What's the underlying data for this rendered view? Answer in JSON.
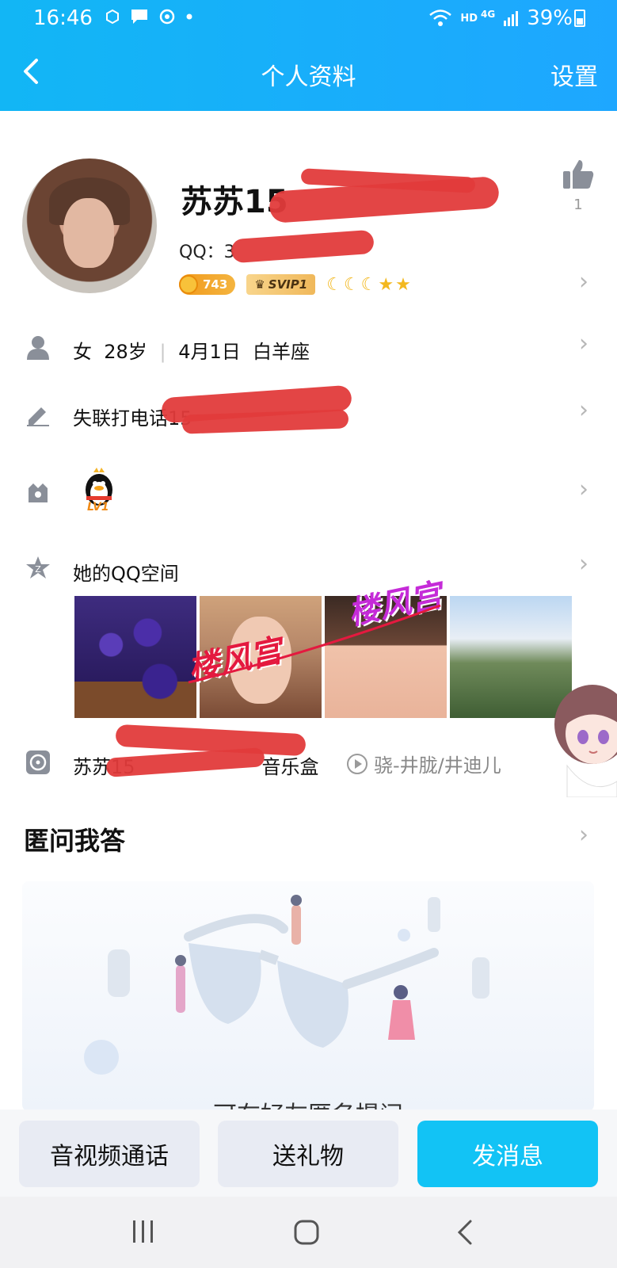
{
  "status_bar": {
    "time": "16:46",
    "network": "HD",
    "network_gen": "4G",
    "battery": "39%"
  },
  "header": {
    "title": "个人资料",
    "settings_label": "设置"
  },
  "profile": {
    "nickname": "苏苏15",
    "qq_label": "QQ：3",
    "like_count": "1",
    "coin_value": "743",
    "svip_label": "SVIP1"
  },
  "info": {
    "gender": "女",
    "age": "28岁",
    "birthday": "4月1日",
    "zodiac": "白羊座",
    "signature": "失联打电话15",
    "penguin_level": "LV1",
    "qzone_label": "她的QQ空间",
    "watermark_1": "楼风宫",
    "watermark_2": "楼风宫",
    "music_box": "苏苏15",
    "music_box_suffix": "音乐盒",
    "song": "骁-井胧/井迪儿"
  },
  "qa": {
    "title": "匿问我答",
    "hint": "可在好友匿名提问"
  },
  "actions": {
    "call_label": "音视频通话",
    "gift_label": "送礼物",
    "message_label": "发消息"
  },
  "colors": {
    "header_start": "#12b6f5",
    "header_end": "#1ea7ff",
    "primary_button": "#12c3f5",
    "secondary_button": "#e8ebf3",
    "redaction": "#e23b3b"
  }
}
